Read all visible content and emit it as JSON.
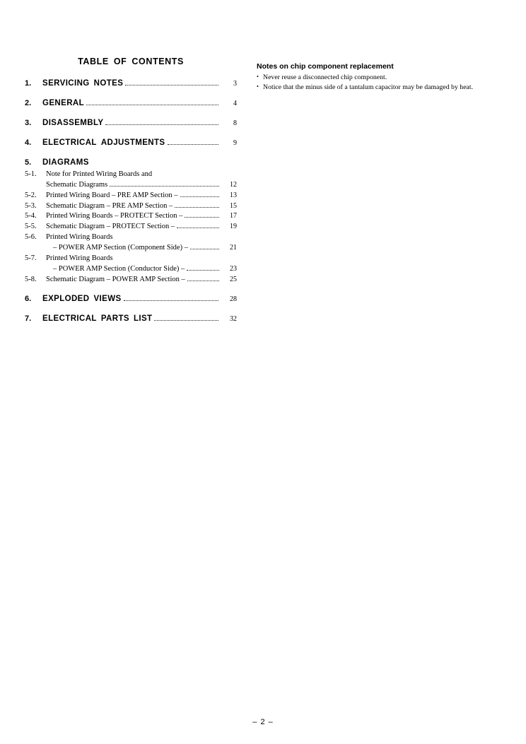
{
  "document": {
    "toc_title_words": [
      "TABLE",
      "OF",
      "CONTENTS"
    ],
    "footer": "– 2 –"
  },
  "toc": {
    "entries": [
      {
        "number": "1.",
        "label_words": [
          "SERVICING",
          "NOTES"
        ],
        "page": "3"
      },
      {
        "number": "2.",
        "label_words": [
          "GENERAL"
        ],
        "page": "4"
      },
      {
        "number": "3.",
        "label_words": [
          "DISASSEMBLY"
        ],
        "page": "8"
      },
      {
        "number": "4.",
        "label_words": [
          "ELECTRICAL",
          "ADJUSTMENTS"
        ],
        "page": "9"
      },
      {
        "number": "5.",
        "label_words": [
          "DIAGRAMS"
        ],
        "page": ""
      },
      {
        "number": "6.",
        "label_words": [
          "EXPLODED",
          "VIEWS"
        ],
        "page": "28"
      },
      {
        "number": "7.",
        "label_words": [
          "ELECTRICAL",
          "PARTS",
          "LIST"
        ],
        "page": "32"
      }
    ],
    "subsections": [
      {
        "number": "5-1.",
        "line1": "Note for Printed Wiring Boards and",
        "line2": "Schematic Diagrams",
        "page": "12"
      },
      {
        "number": "5-2.",
        "line1": "Printed Wiring Board  – PRE AMP Section –",
        "page": "13"
      },
      {
        "number": "5-3.",
        "line1": "Schematic Diagram – PRE AMP Section –",
        "page": "15"
      },
      {
        "number": "5-4.",
        "line1": "Printed Wiring Boards  – PROTECT Section –",
        "page": "17"
      },
      {
        "number": "5-5.",
        "line1": "Schematic Diagram  – PROTECT Section –",
        "page": "19"
      },
      {
        "number": "5-6.",
        "line1": "Printed Wiring Boards",
        "line2": "– POWER AMP Section (Component Side) –",
        "page": "21"
      },
      {
        "number": "5-7.",
        "line1": "Printed Wiring Boards",
        "line2": "– POWER AMP Section (Conductor Side) –",
        "page": "23"
      },
      {
        "number": "5-8.",
        "line1": "Schematic Diagram  – POWER AMP Section –",
        "page": "25"
      }
    ]
  },
  "notes": {
    "heading": "Notes on chip component replacement",
    "bullet_glyph": "•",
    "items": [
      "Never reuse a disconnected chip component.",
      "Notice that the minus side of a tantalum capacitor may be damaged by heat."
    ]
  }
}
